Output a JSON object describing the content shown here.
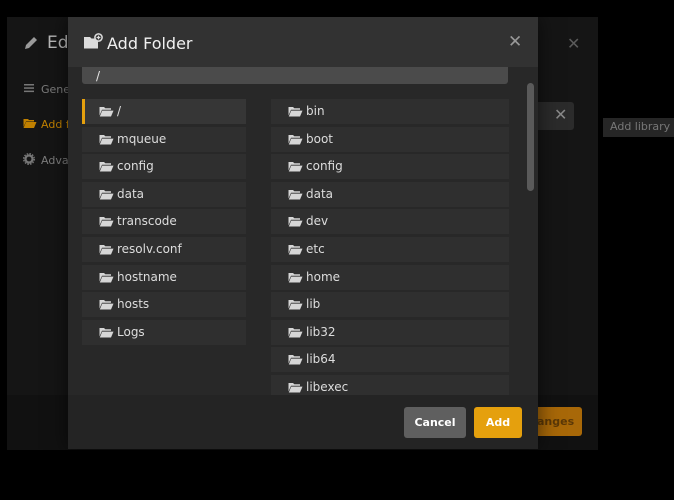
{
  "background_dialog": {
    "title": "Edi",
    "nav": {
      "general": "Gene",
      "folders": "Add f",
      "advanced": "Adva"
    },
    "save_button": "anges",
    "add_library": "Add library"
  },
  "modal": {
    "title": "Add Folder",
    "path_value": "/",
    "left_column": [
      "/",
      "mqueue",
      "config",
      "data",
      "transcode",
      "resolv.conf",
      "hostname",
      "hosts",
      "Logs"
    ],
    "right_column": [
      "bin",
      "boot",
      "config",
      "data",
      "dev",
      "etc",
      "home",
      "lib",
      "lib32",
      "lib64",
      "libexec"
    ],
    "selected_item": "/",
    "cancel_label": "Cancel",
    "add_label": "Add"
  },
  "colors": {
    "accent": "#e5a00d",
    "modal_bg": "#282828",
    "row_bg": "#2f2f2f",
    "cancel_bg": "#5f5f5f"
  },
  "icons": {
    "title": "folder-add-icon",
    "row": "folder-open-icon",
    "close": "close-icon"
  }
}
